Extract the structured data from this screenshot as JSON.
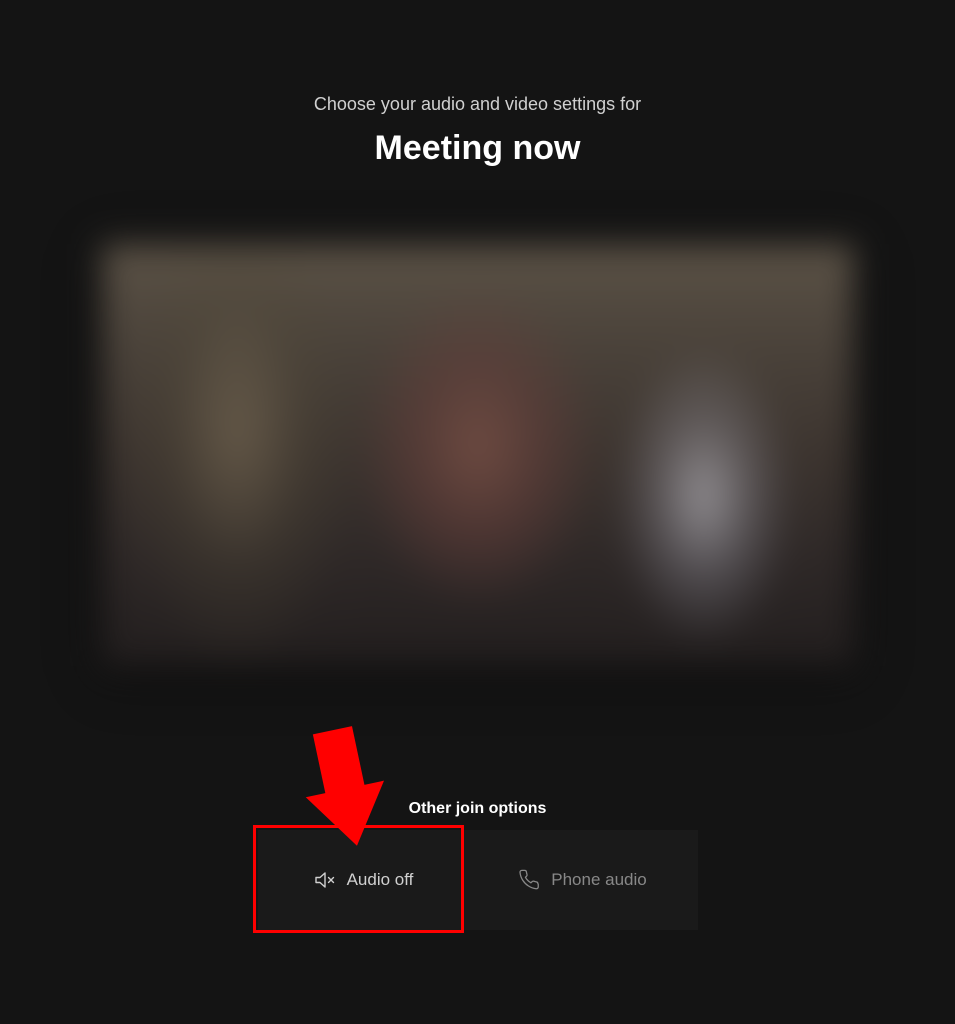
{
  "header": {
    "subtitle": "Choose your audio and video settings for",
    "title": "Meeting now"
  },
  "other_options": {
    "label": "Other join options",
    "audio_off": "Audio off",
    "phone_audio": "Phone audio"
  },
  "annotation": {
    "highlight_target": "audio-off-button"
  }
}
